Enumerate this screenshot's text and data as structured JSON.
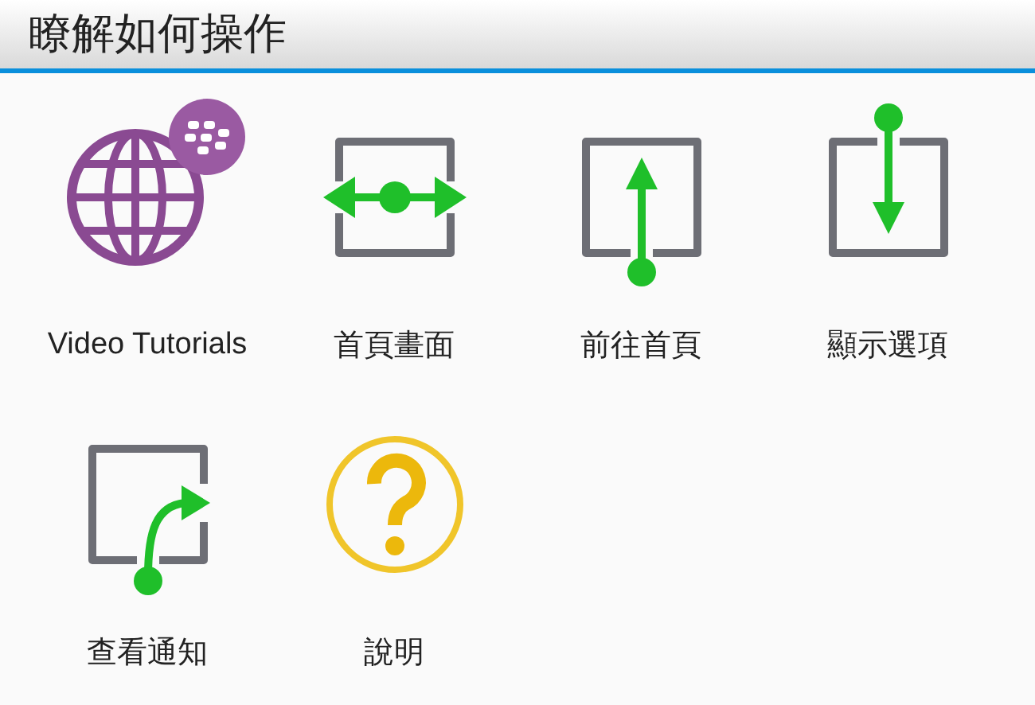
{
  "header": {
    "title": "瞭解如何操作"
  },
  "tiles": [
    {
      "kind": "video",
      "label": "Video Tutorials"
    },
    {
      "kind": "home_screen",
      "label": "首頁畫面"
    },
    {
      "kind": "go_home",
      "label": "前往首頁"
    },
    {
      "kind": "show_options",
      "label": "顯示選項"
    },
    {
      "kind": "notifications",
      "label": "查看通知"
    },
    {
      "kind": "help",
      "label": "說明"
    }
  ]
}
